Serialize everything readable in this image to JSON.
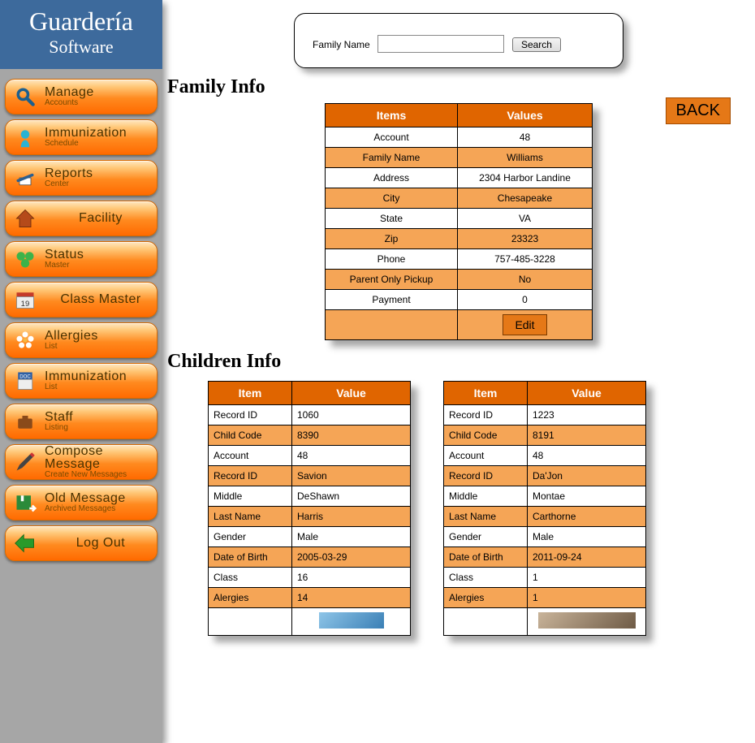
{
  "brand": {
    "line1": "Guardería",
    "line2": "Software"
  },
  "nav": [
    {
      "key": "manage",
      "title": "Manage",
      "sub": "Accounts"
    },
    {
      "key": "immun-sched",
      "title": "Immunization",
      "sub": "Schedule"
    },
    {
      "key": "reports",
      "title": "Reports",
      "sub": "Center"
    },
    {
      "key": "facility",
      "title": "Facility",
      "sub": ""
    },
    {
      "key": "status",
      "title": "Status",
      "sub": "Master"
    },
    {
      "key": "class-master",
      "title": "Class Master",
      "sub": ""
    },
    {
      "key": "allergies",
      "title": "Allergies",
      "sub": "List"
    },
    {
      "key": "immun-list",
      "title": "Immunization",
      "sub": "List"
    },
    {
      "key": "staff",
      "title": "Staff",
      "sub": "Listing"
    },
    {
      "key": "compose",
      "title": "Compose Message",
      "sub": "Create New Messages"
    },
    {
      "key": "old-msg",
      "title": "Old Message",
      "sub": "Archived Messages"
    },
    {
      "key": "logout",
      "title": "Log Out",
      "sub": ""
    }
  ],
  "search": {
    "label": "Family Name",
    "placeholder": "",
    "value": "",
    "button": "Search"
  },
  "headings": {
    "family": "Family Info",
    "children": "Children Info"
  },
  "back_label": "BACK",
  "family_table": {
    "headers": [
      "Items",
      "Values"
    ],
    "rows": [
      [
        "Account",
        "48"
      ],
      [
        "Family Name",
        "Williams"
      ],
      [
        "Address",
        "2304 Harbor Landine"
      ],
      [
        "City",
        "Chesapeake"
      ],
      [
        "State",
        "VA"
      ],
      [
        "Zip",
        "23323"
      ],
      [
        "Phone",
        "757-485-3228"
      ],
      [
        "Parent Only Pickup",
        "No"
      ],
      [
        "Payment",
        "0"
      ]
    ],
    "edit_label": "Edit"
  },
  "child_headers": [
    "Item",
    "Value"
  ],
  "children": [
    {
      "rows": [
        [
          "Record ID",
          "1060"
        ],
        [
          "Child Code",
          "8390"
        ],
        [
          "Account",
          "48"
        ],
        [
          "Record ID",
          "Savion"
        ],
        [
          "Middle",
          "DeShawn"
        ],
        [
          "Last Name",
          "Harris"
        ],
        [
          "Gender",
          "Male"
        ],
        [
          "Date of Birth",
          "2005-03-29"
        ],
        [
          "Class",
          "16"
        ],
        [
          "Alergies",
          "14"
        ]
      ]
    },
    {
      "rows": [
        [
          "Record ID",
          "1223"
        ],
        [
          "Child Code",
          "8191"
        ],
        [
          "Account",
          "48"
        ],
        [
          "Record ID",
          "Da'Jon"
        ],
        [
          "Middle",
          "Montae"
        ],
        [
          "Last Name",
          "Carthorne"
        ],
        [
          "Gender",
          "Male"
        ],
        [
          "Date of Birth",
          "2011-09-24"
        ],
        [
          "Class",
          "1"
        ],
        [
          "Alergies",
          "1"
        ]
      ]
    }
  ]
}
